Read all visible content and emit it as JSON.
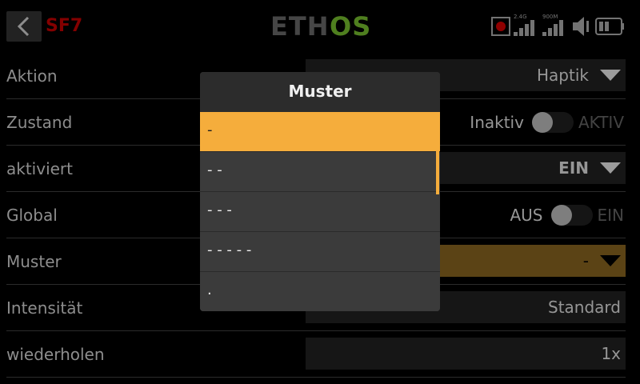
{
  "header": {
    "function_label": "SF7",
    "logo_text": "ETHOS",
    "signal1_label": "2.4G",
    "signal2_label": "900M",
    "icons": [
      "back-arrow-icon",
      "record-icon",
      "signal-2.4g-icon",
      "signal-900m-icon",
      "speaker-icon",
      "battery-icon"
    ]
  },
  "rows": [
    {
      "label": "Aktion",
      "value": "Haptik"
    },
    {
      "label": "Zustand",
      "toggle_off": "Inaktiv",
      "toggle_on": "AKTIV"
    },
    {
      "label": "aktiviert",
      "value": "EIN"
    },
    {
      "label": "Global",
      "toggle_off": "AUS",
      "toggle_on": "EIN"
    },
    {
      "label": "Muster",
      "value": "-"
    },
    {
      "label": "Intensität",
      "value": "Standard"
    },
    {
      "label": "wiederholen",
      "value": "1x"
    }
  ],
  "popup": {
    "title": "Muster",
    "options": [
      "-",
      "- -",
      "- - -",
      "- - - - -",
      "."
    ],
    "selected_index": 0
  },
  "colors": {
    "accent": "#f5ad3c",
    "sf_label": "#b00000",
    "logo_green": "#6aaa2a"
  }
}
